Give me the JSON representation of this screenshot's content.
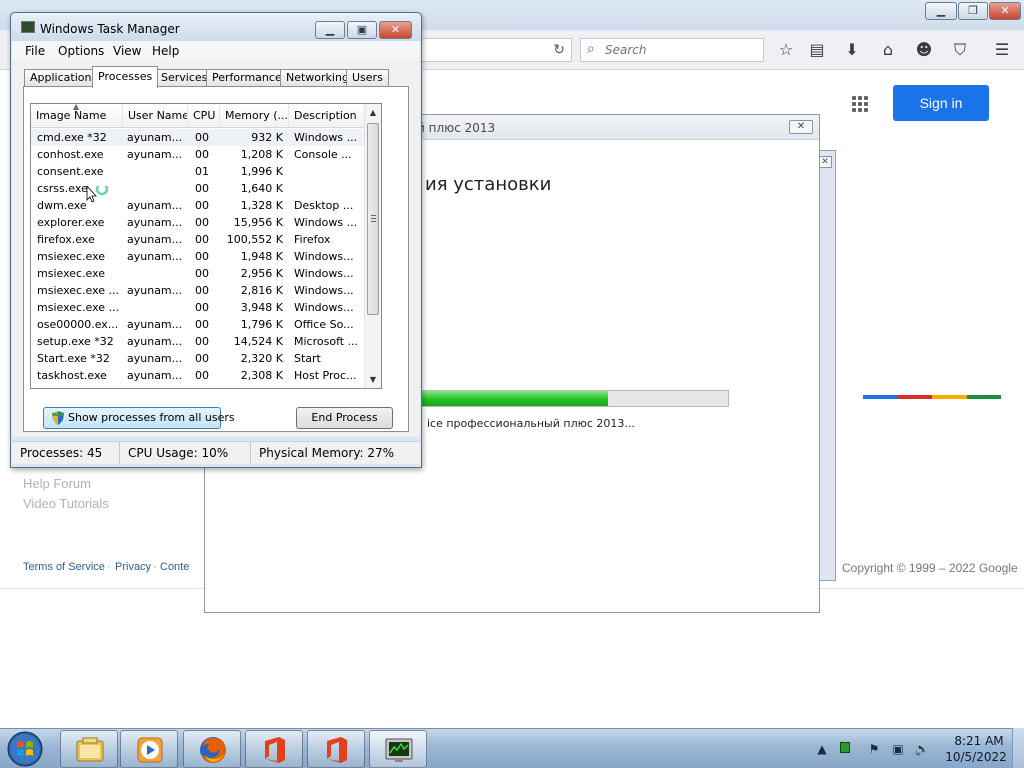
{
  "firefox": {
    "search_placeholder": "Search",
    "toolbar_icons": [
      "star-icon",
      "reading-list-icon",
      "download-icon",
      "home-icon",
      "smiley-icon",
      "pocket-icon",
      "menu-icon"
    ]
  },
  "google": {
    "sign_in": "Sign in",
    "links": [
      "Help Forum",
      "Video Tutorials"
    ],
    "footer": {
      "terms": "Terms of Service",
      "sep1": "·",
      "privacy": "Privacy",
      "sep2": "·",
      "contact": "Conte",
      "copyright": "Copyright © 1999 – 2022 Google"
    },
    "colorbar": [
      "#1a73e8",
      "#d93025",
      "#f9ab00",
      "#1e8e3e"
    ]
  },
  "installer": {
    "title": "й плюс 2013",
    "close": "✕",
    "heading": "ия установки",
    "progress": 0.62,
    "status": "ice профессиональный плюс 2013..."
  },
  "taskmanager": {
    "title": "Windows Task Manager",
    "menu": [
      "File",
      "Options",
      "View",
      "Help"
    ],
    "tabs": [
      "Applications",
      "Processes",
      "Services",
      "Performance",
      "Networking",
      "Users"
    ],
    "active_tab": "Processes",
    "columns": [
      "Image Name",
      "User Name",
      "CPU",
      "Memory (...",
      "Description"
    ],
    "rows": [
      {
        "name": "cmd.exe *32",
        "user": "ayunam...",
        "cpu": "00",
        "mem": "932 K",
        "desc": "Windows ..."
      },
      {
        "name": "conhost.exe",
        "user": "ayunam...",
        "cpu": "00",
        "mem": "1,208 K",
        "desc": "Console ..."
      },
      {
        "name": "consent.exe",
        "user": "",
        "cpu": "01",
        "mem": "1,996 K",
        "desc": ""
      },
      {
        "name": "csrss.exe",
        "user": "",
        "cpu": "00",
        "mem": "1,640 K",
        "desc": ""
      },
      {
        "name": "dwm.exe",
        "user": "ayunam...",
        "cpu": "00",
        "mem": "1,328 K",
        "desc": "Desktop ..."
      },
      {
        "name": "explorer.exe",
        "user": "ayunam...",
        "cpu": "00",
        "mem": "15,956 K",
        "desc": "Windows ..."
      },
      {
        "name": "firefox.exe",
        "user": "ayunam...",
        "cpu": "00",
        "mem": "100,552 K",
        "desc": "Firefox"
      },
      {
        "name": "msiexec.exe",
        "user": "ayunam...",
        "cpu": "00",
        "mem": "1,948 K",
        "desc": "Windows..."
      },
      {
        "name": "msiexec.exe",
        "user": "",
        "cpu": "00",
        "mem": "2,956 K",
        "desc": "Windows..."
      },
      {
        "name": "msiexec.exe ...",
        "user": "ayunam...",
        "cpu": "00",
        "mem": "2,816 K",
        "desc": "Windows..."
      },
      {
        "name": "msiexec.exe ...",
        "user": "",
        "cpu": "00",
        "mem": "3,948 K",
        "desc": "Windows..."
      },
      {
        "name": "ose00000.ex...",
        "user": "ayunam...",
        "cpu": "00",
        "mem": "1,796 K",
        "desc": "Office So..."
      },
      {
        "name": "setup.exe *32",
        "user": "ayunam...",
        "cpu": "00",
        "mem": "14,524 K",
        "desc": "Microsoft ..."
      },
      {
        "name": "Start.exe *32",
        "user": "ayunam...",
        "cpu": "00",
        "mem": "2,320 K",
        "desc": "Start"
      },
      {
        "name": "taskhost.exe",
        "user": "ayunam...",
        "cpu": "00",
        "mem": "2,308 K",
        "desc": "Host Proc..."
      }
    ],
    "show_all_button": "Show processes from all users",
    "end_process_button": "End Process",
    "status": {
      "processes": "Processes: 45",
      "cpu": "CPU Usage: 10%",
      "memory": "Physical Memory: 27%"
    }
  },
  "taskbar": {
    "buttons": [
      "explorer-icon",
      "media-player-icon",
      "firefox-icon",
      "office-icon",
      "office-icon",
      "task-manager-icon"
    ],
    "time": "8:21 AM",
    "date": "10/5/2022"
  }
}
